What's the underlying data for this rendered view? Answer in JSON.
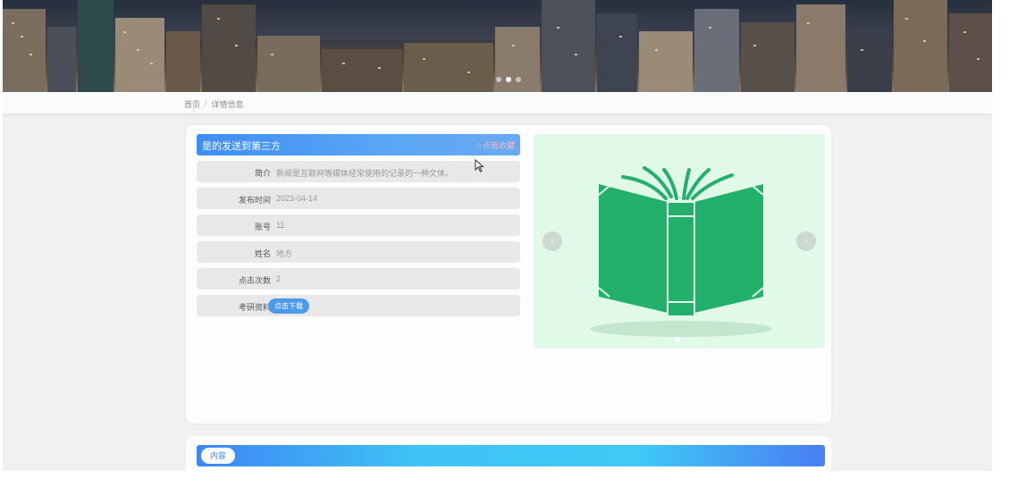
{
  "banner": {
    "slides": 3,
    "active_slide": 2
  },
  "breadcrumb": {
    "home": "首页",
    "separator": "/",
    "current": "详情信息"
  },
  "detail": {
    "title": "是的发送到第三方",
    "favorite_label": "☆点我收藏",
    "fields": [
      {
        "label": "简介",
        "value": "新闻是互联网等媒体经常使用的记录的一种文体。"
      },
      {
        "label": "发布时间",
        "value": "2023-04-14"
      },
      {
        "label": "账号",
        "value": "11"
      },
      {
        "label": "姓名",
        "value": "地方"
      },
      {
        "label": "点击次数",
        "value": "2"
      }
    ],
    "download": {
      "label": "考研资料",
      "button": "点击下载"
    }
  },
  "slider": {
    "prev_icon": "chevron-left-icon",
    "next_icon": "chevron-right-icon",
    "image": "open-book-illustration"
  },
  "content_section": {
    "tab_label": "内容"
  },
  "colors": {
    "accent_blue": "#3e8df4",
    "book_green": "#22b06a",
    "slider_bg": "#e1f9e8"
  }
}
